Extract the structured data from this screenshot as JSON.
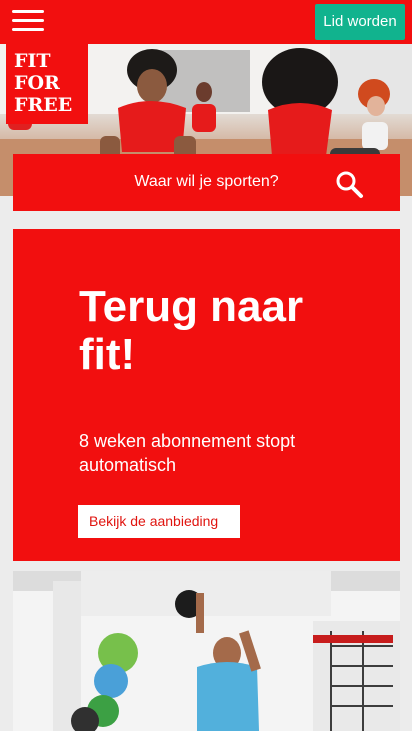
{
  "header": {
    "menu_icon": "hamburger-icon",
    "join_label": "Lid worden",
    "accent": "#f20f0f",
    "join_color": "#11b38e"
  },
  "logo": {
    "lines": [
      "FIT",
      "FOR",
      "FREE"
    ]
  },
  "search": {
    "label": "Waar wil je sporten?",
    "icon": "search-icon"
  },
  "promo": {
    "title_line1": "Terug naar",
    "title_line2": "fit!",
    "subtitle_line1": "8 weken abonnement stopt",
    "subtitle_line2": "automatisch",
    "cta_label": "Bekijk de aanbieding"
  }
}
